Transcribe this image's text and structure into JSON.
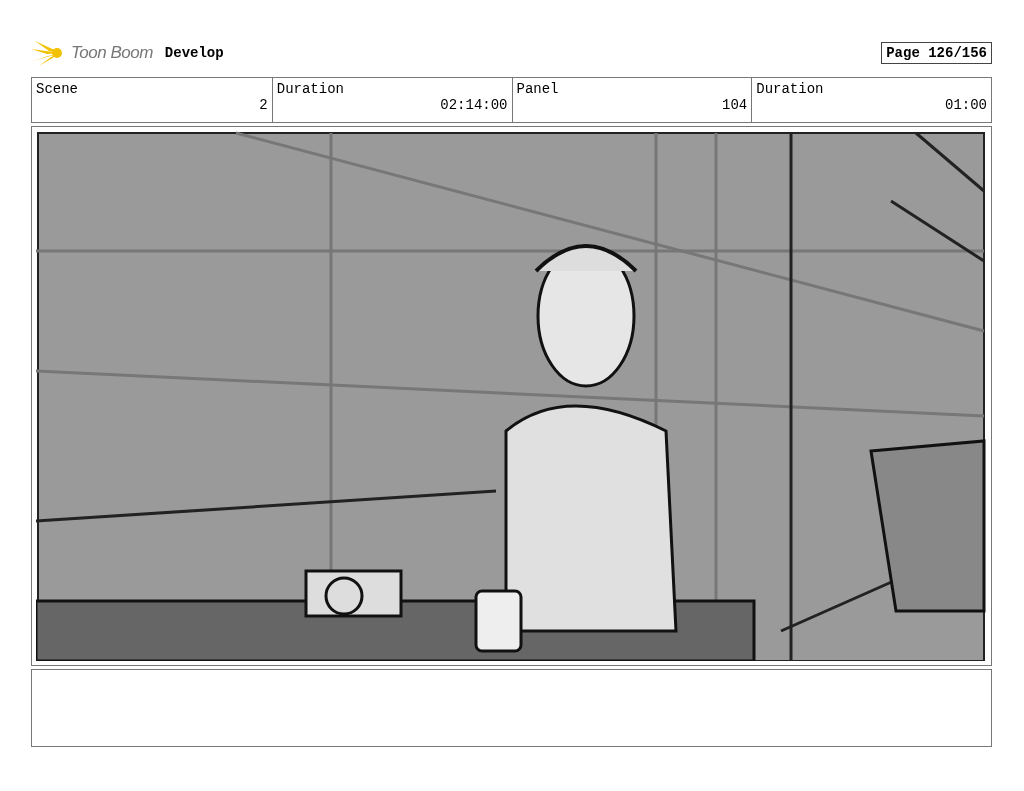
{
  "header": {
    "logo_text": "Toon Boom",
    "project": "Develop",
    "page": "Page 126/156"
  },
  "info_table": {
    "columns": [
      "Scene",
      "Duration",
      "Panel",
      "Duration"
    ],
    "rows": [
      [
        "2",
        "02:14:00",
        "104",
        "01:00"
      ]
    ]
  }
}
